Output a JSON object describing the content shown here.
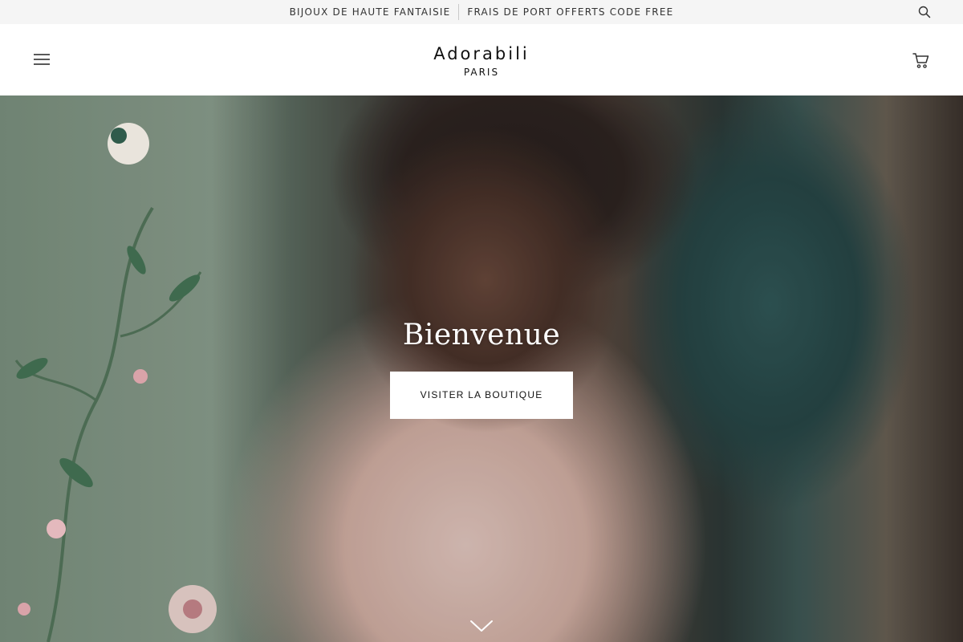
{
  "announcement": {
    "messages": [
      "BIJOUX DE HAUTE FANTAISIE",
      "FRAIS DE PORT OFFERTS CODE FREE"
    ],
    "search_icon": "search-icon"
  },
  "header": {
    "menu_icon": "hamburger-menu-icon",
    "logo_brand": "Adorabili",
    "logo_city": "PARIS",
    "cart_icon": "shopping-cart-icon"
  },
  "hero": {
    "title": "Bienvenue",
    "cta_label": "VISITER LA BOUTIQUE",
    "scroll_icon": "chevron-down-icon"
  },
  "colors": {
    "announcement_bg": "#f5f5f5",
    "header_bg": "#ffffff",
    "cta_bg": "#ffffff",
    "hero_text": "#ffffff"
  }
}
